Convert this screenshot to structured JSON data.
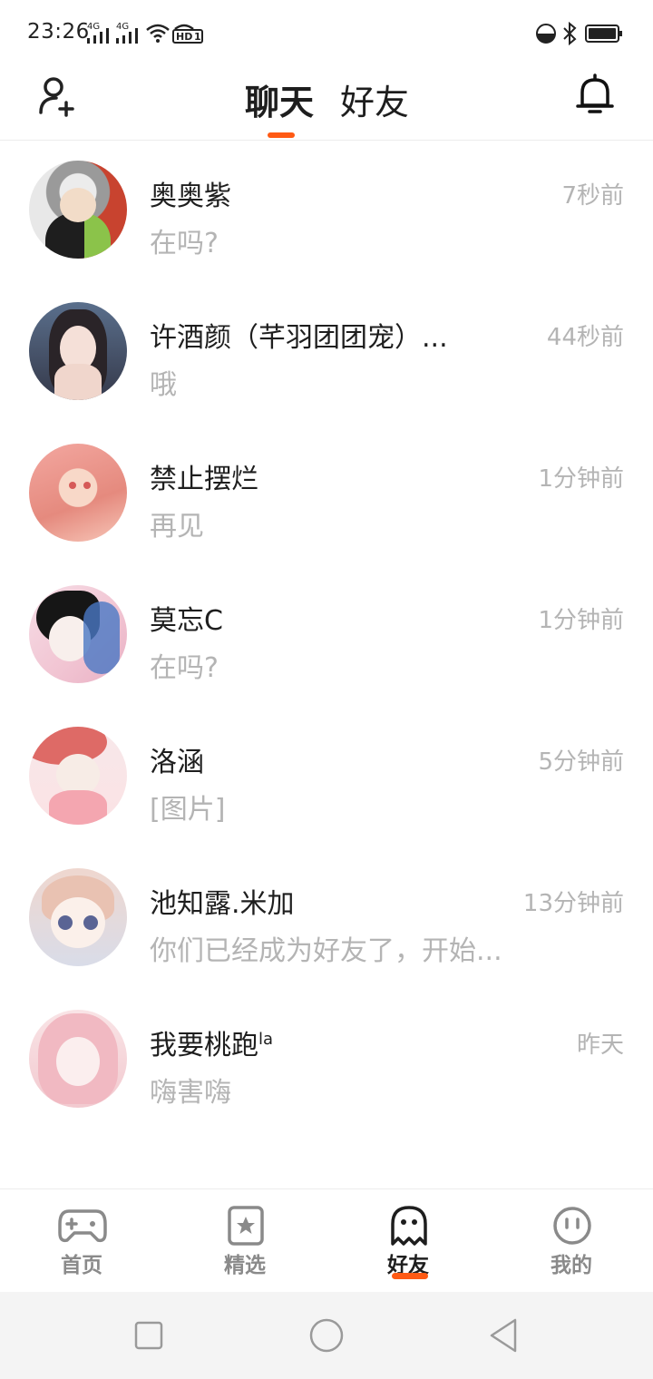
{
  "status_bar": {
    "time": "23:26",
    "network_1": "4G",
    "network_2": "4G",
    "hd_label": "HD",
    "hd_sub": "1"
  },
  "header": {
    "tab_chat": "聊天",
    "tab_friends": "好友",
    "active_tab": "聊天"
  },
  "chats": [
    {
      "name": "奥奥紫",
      "name_sup": "",
      "preview": "在吗?",
      "time": "7秒前"
    },
    {
      "name": "许酒颜（芊羽团团宠）...",
      "name_sup": "",
      "preview": "哦",
      "time": "44秒前"
    },
    {
      "name": "禁止摆烂",
      "name_sup": "",
      "preview": "再见",
      "time": "1分钟前"
    },
    {
      "name": "莫忘C",
      "name_sup": "",
      "preview": "在吗?",
      "time": "1分钟前"
    },
    {
      "name": "洛涵",
      "name_sup": "",
      "preview": "[图片]",
      "time": "5分钟前"
    },
    {
      "name": "池知露.米加",
      "name_sup": "",
      "preview": "你们已经成为好友了，开始...",
      "time": "13分钟前"
    },
    {
      "name": "我要桃跑",
      "name_sup": "la",
      "preview": "嗨害嗨",
      "time": "昨天"
    }
  ],
  "bottom_nav": {
    "items": [
      {
        "label": "首页",
        "icon": "gamepad-icon"
      },
      {
        "label": "精选",
        "icon": "star-badge-icon"
      },
      {
        "label": "好友",
        "icon": "ghost-icon"
      },
      {
        "label": "我的",
        "icon": "face-icon"
      }
    ],
    "active": "好友"
  },
  "colors": {
    "accent": "#ff5a14",
    "text_primary": "#1e1e1e",
    "text_secondary": "#b4b4b4",
    "nav_inactive": "#8a8a8a"
  }
}
